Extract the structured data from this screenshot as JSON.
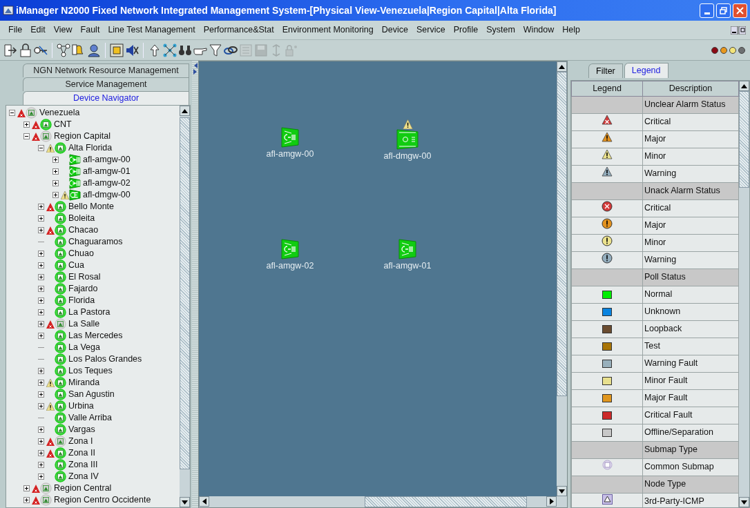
{
  "window": {
    "title": "iManager N2000 Fixed Network Integrated Management System-[Physical View-Venezuela|Region Capital|Alta Florida]"
  },
  "menu": [
    "File",
    "Edit",
    "View",
    "Fault",
    "Line Test Management",
    "Performance&Stat",
    "Environment Monitoring",
    "Device",
    "Service",
    "Profile",
    "System",
    "Window",
    "Help"
  ],
  "toolbar": [
    [
      {
        "disabled": false
      },
      {
        "disabled": false
      },
      {
        "disabled": false
      }
    ],
    [
      {
        "disabled": false
      },
      {
        "disabled": false
      },
      {
        "disabled": false
      }
    ],
    [
      {
        "disabled": false
      },
      {
        "disabled": false
      }
    ],
    [
      {
        "disabled": false
      },
      {
        "disabled": false
      },
      {
        "disabled": false
      },
      {
        "disabled": false
      },
      {
        "disabled": false
      },
      {
        "disabled": false
      },
      {
        "disabled": true
      },
      {
        "disabled": true
      },
      {
        "disabled": true
      },
      {
        "disabled": true
      }
    ]
  ],
  "alarm_lights": [
    {
      "color": "#8a0a14"
    },
    {
      "color": "#e8981e"
    },
    {
      "color": "#f2e47a"
    },
    {
      "color": "#6e7072"
    }
  ],
  "left_tabs": [
    {
      "label": "NGN Network Resource Management",
      "selected": false
    },
    {
      "label": "Service Management",
      "selected": false
    },
    {
      "label": "Device Navigator",
      "selected": true
    }
  ],
  "tree": [
    {
      "label": "Venezuela",
      "kind": "submap",
      "alarm": {
        "color": "#d42222",
        "cross": true
      },
      "offline": true,
      "expanded": true,
      "children": [
        {
          "label": "CNT",
          "kind": "submap",
          "alarm": {
            "color": "#d42222",
            "cross": true
          },
          "offline": false,
          "expanded": false
        },
        {
          "label": "Region Capital",
          "kind": "submap",
          "alarm": {
            "color": "#d42222",
            "cross": true
          },
          "offline": true,
          "expanded": true,
          "children": [
            {
              "label": "Alta Florida",
              "kind": "submap",
              "alarm": {
                "color": "#eee08a",
                "cross": false
              },
              "offline": false,
              "expanded": true,
              "children": [
                {
                  "label": "afl-amgw-00",
                  "kind": "amgw",
                  "expanded": false
                },
                {
                  "label": "afl-amgw-01",
                  "kind": "amgw",
                  "expanded": false
                },
                {
                  "label": "afl-amgw-02",
                  "kind": "amgw",
                  "expanded": false
                },
                {
                  "label": "afl-dmgw-00",
                  "kind": "dmgw",
                  "alarm": {
                    "color": "#eee08a",
                    "cross": false
                  },
                  "expanded": false
                }
              ]
            },
            {
              "label": "Bello Monte",
              "kind": "submap",
              "alarm": {
                "color": "#d42222",
                "cross": true
              },
              "offline": false,
              "expanded": false
            },
            {
              "label": "Boleita",
              "kind": "submap",
              "offline": false,
              "expanded": false
            },
            {
              "label": "Chacao",
              "kind": "submap",
              "alarm": {
                "color": "#d42222",
                "cross": true
              },
              "offline": false,
              "expanded": false
            },
            {
              "label": "Chaguaramos",
              "kind": "submap",
              "offline": false
            },
            {
              "label": "Chuao",
              "kind": "submap",
              "offline": false,
              "expanded": false
            },
            {
              "label": "Cua",
              "kind": "submap",
              "offline": false,
              "expanded": false
            },
            {
              "label": "El Rosal",
              "kind": "submap",
              "offline": false,
              "expanded": false
            },
            {
              "label": "Fajardo",
              "kind": "submap",
              "offline": false,
              "expanded": false
            },
            {
              "label": "Florida",
              "kind": "submap",
              "offline": false,
              "expanded": false
            },
            {
              "label": "La Pastora",
              "kind": "submap",
              "offline": false,
              "expanded": false
            },
            {
              "label": "La Salle",
              "kind": "submap",
              "alarm": {
                "color": "#d42222",
                "cross": true
              },
              "offline": true,
              "expanded": false
            },
            {
              "label": "Las Mercedes",
              "kind": "submap",
              "offline": false,
              "expanded": false
            },
            {
              "label": "La Vega",
              "kind": "submap",
              "offline": false
            },
            {
              "label": "Los Palos Grandes",
              "kind": "submap",
              "offline": false
            },
            {
              "label": "Los Teques",
              "kind": "submap",
              "offline": false,
              "expanded": false
            },
            {
              "label": "Miranda",
              "kind": "submap",
              "alarm": {
                "color": "#eee08a",
                "cross": false
              },
              "offline": false,
              "expanded": false
            },
            {
              "label": "San Agustin",
              "kind": "submap",
              "offline": false,
              "expanded": false
            },
            {
              "label": "Urbina",
              "kind": "submap",
              "alarm": {
                "color": "#eee08a",
                "cross": false
              },
              "offline": false,
              "expanded": false
            },
            {
              "label": "Valle Arriba",
              "kind": "submap",
              "offline": false
            },
            {
              "label": "Vargas",
              "kind": "submap",
              "offline": false,
              "expanded": false
            },
            {
              "label": "Zona I",
              "kind": "submap",
              "alarm": {
                "color": "#d42222",
                "cross": true
              },
              "offline": true,
              "expanded": false
            },
            {
              "label": "Zona II",
              "kind": "submap",
              "alarm": {
                "color": "#d42222",
                "cross": true
              },
              "offline": false,
              "expanded": false
            },
            {
              "label": "Zona III",
              "kind": "submap",
              "offline": false,
              "expanded": false
            },
            {
              "label": "Zona IV",
              "kind": "submap",
              "offline": false,
              "expanded": false
            }
          ]
        },
        {
          "label": "Region Central",
          "kind": "submap",
          "alarm": {
            "color": "#d42222",
            "cross": true
          },
          "offline": true,
          "expanded": false
        },
        {
          "label": "Region Centro Occidente",
          "kind": "submap",
          "alarm": {
            "color": "#d42222",
            "cross": true
          },
          "offline": true,
          "expanded": false
        }
      ]
    }
  ],
  "map_nodes": [
    {
      "label": "afl-amgw-00",
      "kind": "amgw"
    },
    {
      "label": "afl-dmgw-00",
      "kind": "dmgw",
      "alarm": {
        "color": "#eee08a",
        "cross": false
      }
    },
    {
      "label": "afl-amgw-02",
      "kind": "amgw"
    },
    {
      "label": "afl-amgw-01",
      "kind": "amgw"
    }
  ],
  "right_tabs": [
    {
      "label": "Filter",
      "selected": false
    },
    {
      "label": "Legend",
      "selected": true
    }
  ],
  "legend": {
    "columns": [
      "Legend",
      "Description"
    ],
    "rows": [
      {
        "kind": "section",
        "description": "Unclear Alarm Status"
      },
      {
        "kind": "triangle",
        "cross": true,
        "color": "#d33a3a",
        "description": "Critical"
      },
      {
        "kind": "triangle",
        "cross": false,
        "color": "#e3921e",
        "description": "Major"
      },
      {
        "kind": "triangle",
        "cross": false,
        "color": "#ece38e",
        "description": "Minor"
      },
      {
        "kind": "triangle",
        "cross": false,
        "color": "#93adbd",
        "description": "Warning"
      },
      {
        "kind": "section",
        "description": "Unack Alarm Status"
      },
      {
        "kind": "circle",
        "cross": true,
        "color": "#d33a3a",
        "description": "Critical"
      },
      {
        "kind": "circle",
        "cross": false,
        "color": "#e3921e",
        "description": "Major"
      },
      {
        "kind": "circle",
        "cross": false,
        "color": "#ece38e",
        "description": "Minor"
      },
      {
        "kind": "circle",
        "cross": false,
        "color": "#93adbd",
        "description": "Warning"
      },
      {
        "kind": "section",
        "description": "Poll Status"
      },
      {
        "kind": "swatch",
        "color": "#00ee00",
        "description": "Normal"
      },
      {
        "kind": "swatch",
        "color": "#0a84e0",
        "description": "Unknown"
      },
      {
        "kind": "swatch",
        "color": "#6a4c30",
        "description": "Loopback"
      },
      {
        "kind": "swatch",
        "color": "#a87406",
        "description": "Test"
      },
      {
        "kind": "swatch",
        "color": "#98b0bc",
        "description": "Warning Fault"
      },
      {
        "kind": "swatch",
        "color": "#e8e08e",
        "description": "Minor Fault"
      },
      {
        "kind": "swatch",
        "color": "#e0961e",
        "description": "Major Fault"
      },
      {
        "kind": "swatch",
        "color": "#cc2a2a",
        "description": "Critical Fault"
      },
      {
        "kind": "swatch",
        "color": "#c8c8c8",
        "description": "Offline/Separation"
      },
      {
        "kind": "section",
        "description": "Submap Type"
      },
      {
        "kind": "submap",
        "description": "Common Submap"
      },
      {
        "kind": "section",
        "description": "Node Type"
      },
      {
        "kind": "node",
        "description": "3rd-Party-ICMP"
      }
    ]
  }
}
